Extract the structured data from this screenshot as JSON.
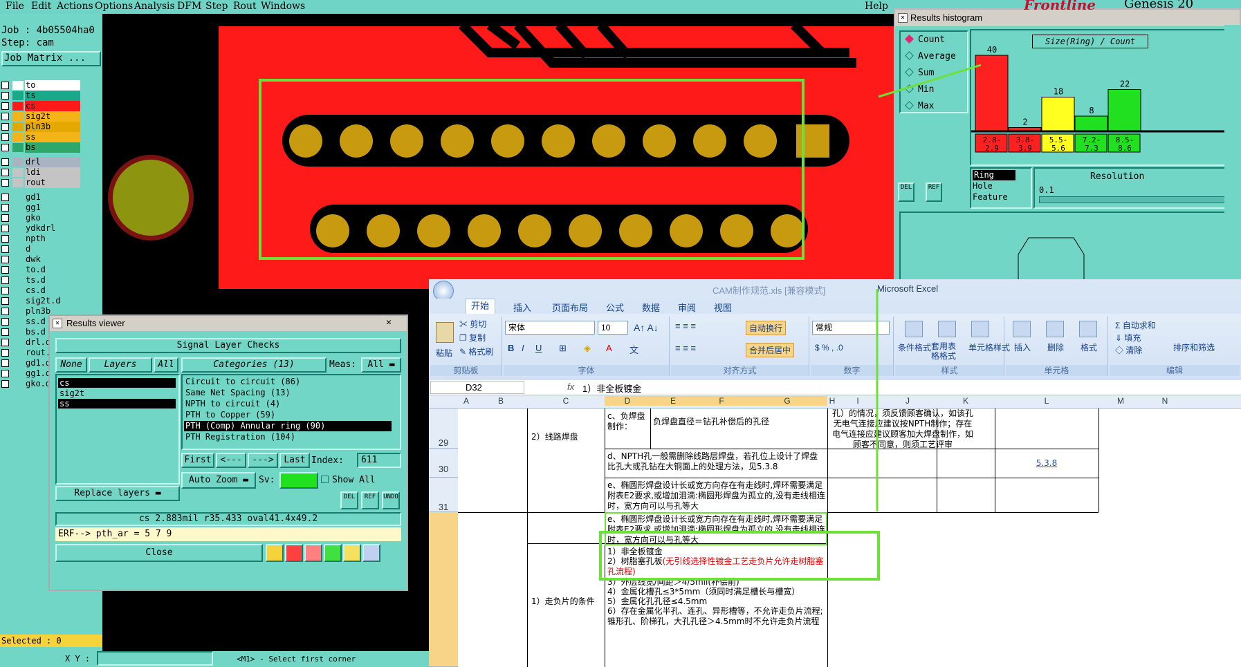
{
  "genesis": {
    "menu": [
      "File",
      "Edit",
      "Actions",
      "Options",
      "Analysis",
      "DFM",
      "Step",
      "Rout",
      "Windows"
    ],
    "help": "Help",
    "brand": "Frontline",
    "brand2": "Genesis 20",
    "job_label": "Job : 4b05504ha0",
    "step_label": "Step: cam",
    "job_matrix": "Job Matrix ...",
    "layers": [
      {
        "name": "to",
        "color": "#ffffff"
      },
      {
        "name": "ts",
        "color": "#1aa88a"
      },
      {
        "name": "cs",
        "color": "#ff1a1a"
      },
      {
        "name": "sig2t",
        "color": "#f2b418"
      },
      {
        "name": "pln3b",
        "color": "#e4a800"
      },
      {
        "name": "ss",
        "color": "#f2b418"
      },
      {
        "name": "bs",
        "color": "#2ea86a"
      },
      {
        "name": "drl",
        "color": "#a8b4c2"
      },
      {
        "name": "ldi",
        "color": "#c4c4c4"
      },
      {
        "name": "rout",
        "color": "#c4c4c4"
      },
      {
        "name": "gd1",
        "color": "#72d6c7"
      },
      {
        "name": "gg1",
        "color": "#72d6c7"
      },
      {
        "name": "gko",
        "color": "#72d6c7"
      },
      {
        "name": "ydkdrl",
        "color": "#72d6c7"
      },
      {
        "name": "npth",
        "color": "#72d6c7"
      },
      {
        "name": "d",
        "color": "#72d6c7"
      },
      {
        "name": "dwk",
        "color": "#72d6c7"
      },
      {
        "name": "to.d",
        "color": "#72d6c7"
      },
      {
        "name": "ts.d",
        "color": "#72d6c7"
      },
      {
        "name": "cs.d",
        "color": "#72d6c7"
      },
      {
        "name": "sig2t.d",
        "color": "#72d6c7"
      },
      {
        "name": "pln3b",
        "color": "#72d6c7"
      },
      {
        "name": "ss.d",
        "color": "#72d6c7"
      },
      {
        "name": "bs.d",
        "color": "#72d6c7"
      },
      {
        "name": "drl.d",
        "color": "#72d6c7"
      },
      {
        "name": "rout.",
        "color": "#72d6c7"
      },
      {
        "name": "gd1.d",
        "color": "#72d6c7"
      },
      {
        "name": "gg1.d",
        "color": "#72d6c7"
      },
      {
        "name": "gko.d",
        "color": "#72d6c7"
      }
    ],
    "selected": "Selected : 0",
    "xy_label": "X Y :",
    "status": "<M1> - Select first corner"
  },
  "histogram": {
    "title": "Results histogram",
    "options": [
      "Count",
      "Average",
      "Sum",
      "Min",
      "Max"
    ],
    "chart_title": "Size(Ring) / Count",
    "bars": [
      {
        "label": "2.8-2.9",
        "value": 40,
        "color": "#ff2020"
      },
      {
        "label": "3.8-3.9",
        "value": 2,
        "color": "#ff2020"
      },
      {
        "label": "5.5-5.6",
        "value": 18,
        "color": "#ffff20"
      },
      {
        "label": "7.2-7.3",
        "value": 8,
        "color": "#20e020"
      },
      {
        "label": "8.5-8.6",
        "value": 22,
        "color": "#20e020"
      }
    ],
    "labels_top": [
      "2.8-",
      "3.8-",
      "5.5-",
      "7.2-",
      "8.5-"
    ],
    "labels_bot": [
      "2.9",
      "3.9",
      "5.6",
      "7.3",
      "8.6"
    ],
    "type_options": [
      "Ring",
      "Hole",
      "Feature"
    ],
    "resolution_label": "Resolution",
    "resolution_value": "0.1",
    "del": "DEL",
    "ref": "REF"
  },
  "viewer": {
    "title": "Results viewer",
    "header": "Signal Layer Checks",
    "none": "None",
    "layers": "Layers",
    "all": "All",
    "categories": "Categories (13)",
    "meas": "Meas:",
    "meas_val": "All",
    "layer_list": [
      "cs",
      "sig2t",
      "ss"
    ],
    "category_list": [
      "Circuit to circuit (86)",
      "Same Net Spacing (13)",
      "NPTH to circuit (4)",
      "PTH to Copper (59)",
      "PTH (Comp) Annular ring (90)",
      "PTH Registration (104)"
    ],
    "first": "First",
    "prev": "<---",
    "next": "--->",
    "last": "Last",
    "index_label": "Index:",
    "index_val": "611",
    "auto_zoom": "Auto Zoom",
    "sv": "Sv:",
    "show_all": "Show All",
    "replace": "Replace layers",
    "info_line": "cs 2.883mil  r35.433  oval41.4x49.2",
    "erf_line": "ERF--> pth_ar = 5 7 9",
    "close": "Close",
    "del": "DEL",
    "ref": "REF",
    "undo": "UNDO"
  },
  "excel": {
    "title": "Microsoft Excel",
    "file_title": "CAM制作规范.xls  [兼容模式]",
    "tabs": [
      "开始",
      "插入",
      "页面布局",
      "公式",
      "数据",
      "审阅",
      "视图"
    ],
    "clipboard": {
      "paste": "粘贴",
      "cut": "剪切",
      "copy": "复制",
      "fmt": "格式刷",
      "group": "剪贴板"
    },
    "font": {
      "name": "宋体",
      "size": "10",
      "group": "字体"
    },
    "align": {
      "wrap": "自动换行",
      "merge": "合并后居中",
      "group": "对齐方式"
    },
    "number": {
      "fmt": "常规",
      "group": "数字"
    },
    "styles": {
      "cond": "条件格式",
      "table": "套用表格格式",
      "cell": "单元格样式",
      "group": "样式"
    },
    "cells": {
      "insert": "插入",
      "delete": "删除",
      "format": "格式",
      "group": "单元格"
    },
    "edit": {
      "sum": "自动求和",
      "fill": "填充",
      "clear": "清除",
      "sort": "排序和筛选",
      "group": "编辑"
    },
    "cell_ref": "D32",
    "fx": "fx",
    "formula": "1）非全板镀金",
    "columns": [
      "A",
      "B",
      "C",
      "D",
      "E",
      "F",
      "G",
      "H",
      "I",
      "J",
      "K",
      "L",
      "M",
      "N"
    ],
    "rows": [
      {
        "num": "29",
        "c": "2）线路焊盘",
        "d": "c、负焊盘制作：",
        "efg": "负焊盘直径＝钻孔补偿后的孔径",
        "ijk": "孔）的情况，须反馈顾客确认，如该孔无电气连接应建议按NPTH制作；存在电气连接应建议顾客加大焊盘制作，如顾客不同意，则须工艺评审"
      },
      {
        "num": "30",
        "defg": "d、NPTH孔一般需删除线路层焊盘，若孔位上设计了焊盘比孔大或孔钻在大铜面上的处理方法，见5.3.8",
        "l": "5.3.8"
      },
      {
        "num": "31",
        "defg": "e、椭圆形焊盘设计长或宽方向存在有走线时,焊环需要满足附表E2要求,或增加泪滴:椭圆形焊盘为孤立的,没有走线相连时，宽方向可以与孔等大"
      },
      {
        "num": "32",
        "defg": "e、椭圆形焊盘设计长或宽方向存在有走线时,焊环需要满足附表E2要求,或增加泪滴:椭圆形焊盘为孤立的,没有走线相连时，宽方向可以与孔等大"
      }
    ],
    "cond_lines": [
      "1）非全板镀金",
      "2）树脂塞孔板",
      "3）外层线宽/间距＞4/5mil(补偿前)",
      "4）金属化槽孔≤3*5mm（须同时满足槽长与槽宽）",
      "5）金属化孔孔径≤4.5mm",
      "6）存在金属化半孔、连孔、异形槽等，不允许走负片流程;锥形孔、阶梯孔，大孔孔径＞4.5mm时不允许走负片流程"
    ],
    "cond_red": "(无引线选择性镀金工艺走负片允许走树脂塞孔流程)",
    "cond_c": "1）走负片的条件"
  }
}
